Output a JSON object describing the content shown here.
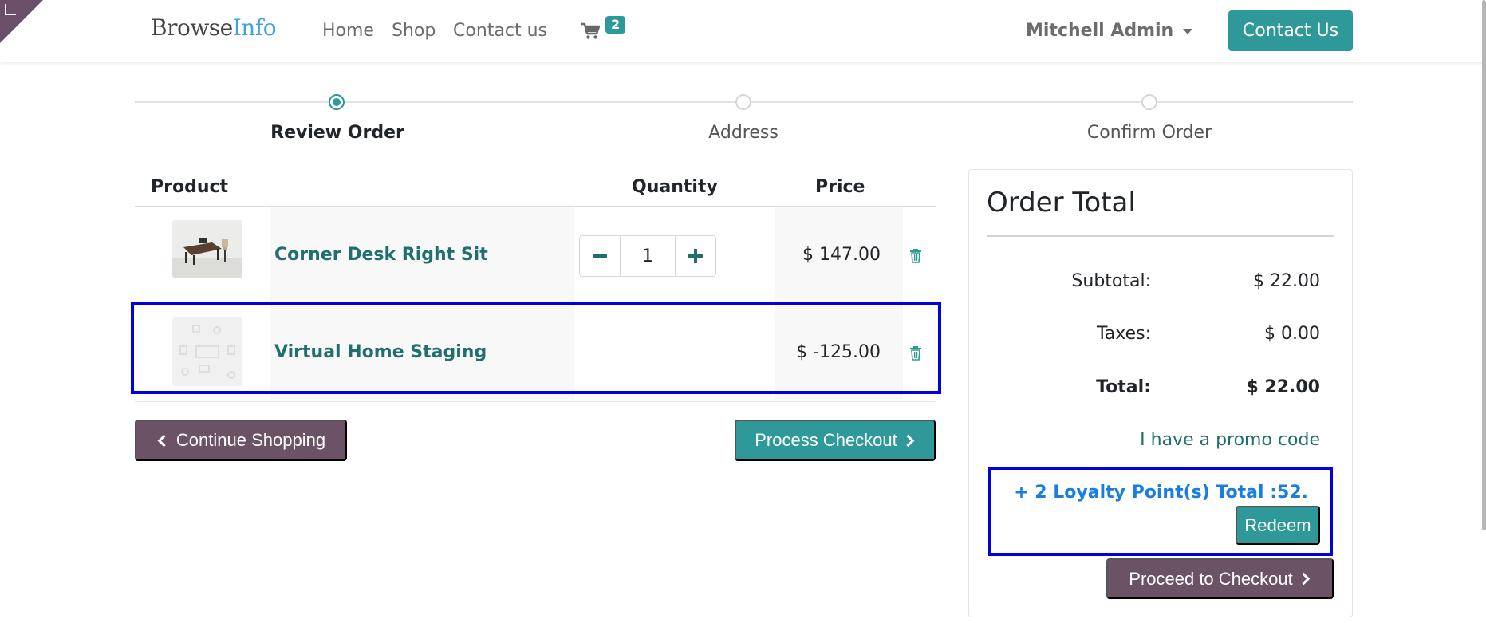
{
  "brand": {
    "logo_part1": "Browse",
    "logo_part2": "Info"
  },
  "nav": {
    "items": [
      {
        "label": "Home"
      },
      {
        "label": "Shop"
      },
      {
        "label": "Contact us"
      }
    ],
    "cart_count": "2",
    "user_name": "Mitchell Admin",
    "contact_button": "Contact Us"
  },
  "steps": [
    {
      "label": "Review Order",
      "active": true
    },
    {
      "label": "Address",
      "active": false
    },
    {
      "label": "Confirm Order",
      "active": false
    }
  ],
  "cart": {
    "headers": {
      "product": "Product",
      "quantity": "Quantity",
      "price": "Price"
    },
    "rows": [
      {
        "name": "Corner Desk Right Sit",
        "quantity": "1",
        "price": "$ 147.00"
      },
      {
        "name": "Virtual Home Staging",
        "quantity": "",
        "price": "$ -125.00"
      }
    ],
    "continue_button": "Continue Shopping",
    "process_button": "Process Checkout"
  },
  "order_total": {
    "title": "Order Total",
    "subtotal_label": "Subtotal:",
    "subtotal_value": "$ 22.00",
    "taxes_label": "Taxes:",
    "taxes_value": "$ 0.00",
    "total_label": "Total:",
    "total_value": "$ 22.00",
    "promo_link": "I have a promo code",
    "loyalty_text": "+ 2 Loyalty Point(s) Total :52.",
    "redeem_button": "Redeem",
    "proceed_button": "Proceed to Checkout"
  },
  "colors": {
    "primary": "#2f9999",
    "secondary": "#6b5365",
    "link": "#206f6c",
    "loyalty": "#1a7de0",
    "highlight": "#0000e0"
  }
}
